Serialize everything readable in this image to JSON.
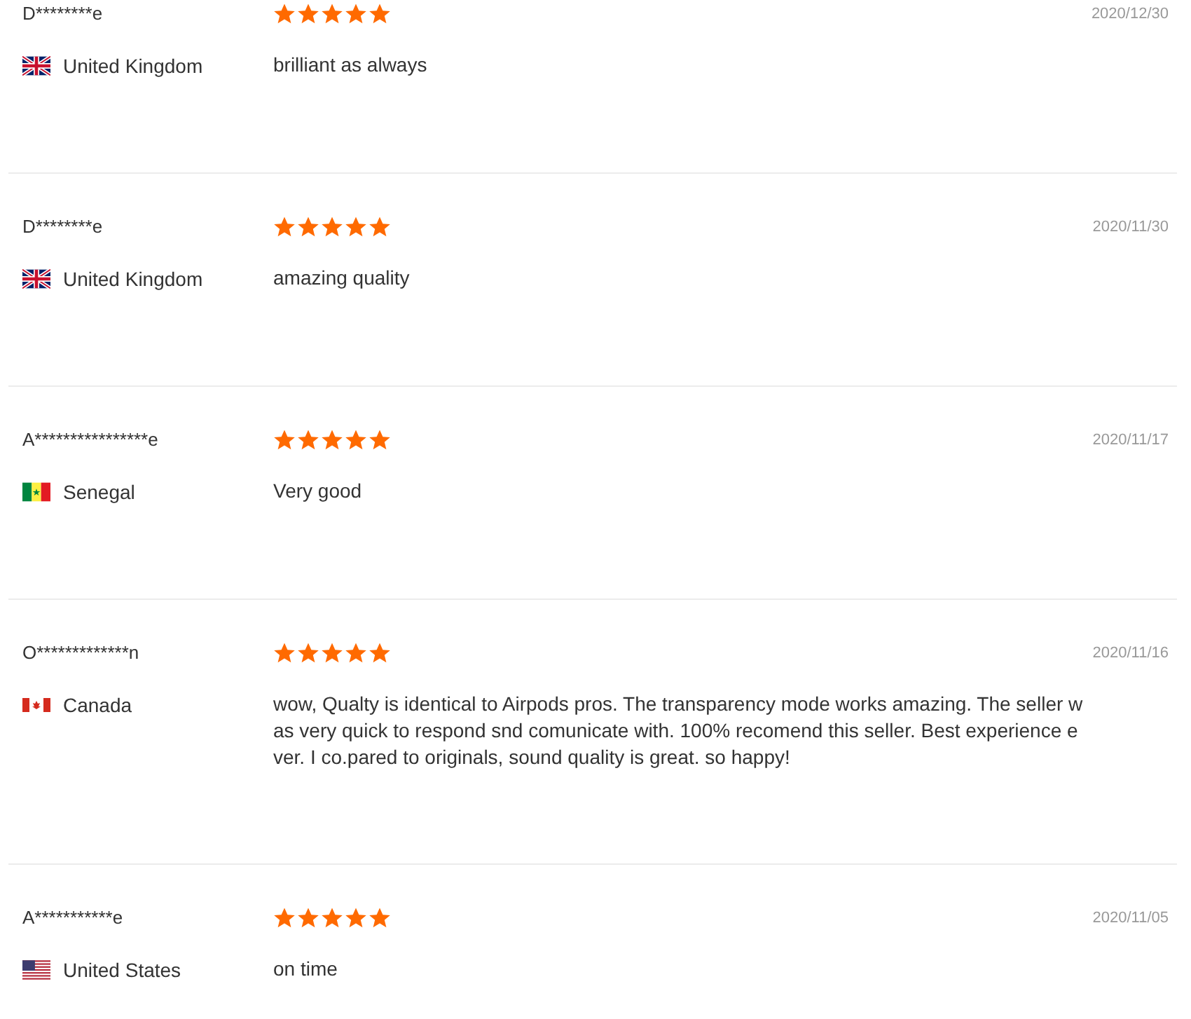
{
  "reviews": [
    {
      "name": "D********e",
      "country": "United Kingdom",
      "kind": "gb",
      "stars": 5,
      "date": "2020/12/30",
      "comment": "brilliant as always"
    },
    {
      "name": "D********e",
      "country": "United Kingdom",
      "kind": "gb",
      "stars": 5,
      "date": "2020/11/30",
      "comment": "amazing quality"
    },
    {
      "name": "A****************e",
      "country": "Senegal",
      "kind": "sn",
      "stars": 5,
      "date": "2020/11/17",
      "comment": "Very good"
    },
    {
      "name": "O*************n",
      "country": "Canada",
      "kind": "ca",
      "stars": 5,
      "date": "2020/11/16",
      "comment": "wow, Qualty is identical to Airpods pros. The transparency mode works amazing. The seller was very quick to respond snd comunicate with. 100% recomend this seller. Best experience ever. I co.pared to originals, sound quality is great. so happy!"
    },
    {
      "name": "A***********e",
      "country": "United States",
      "kind": "us",
      "stars": 5,
      "date": "2020/11/05",
      "comment": "on time"
    }
  ]
}
